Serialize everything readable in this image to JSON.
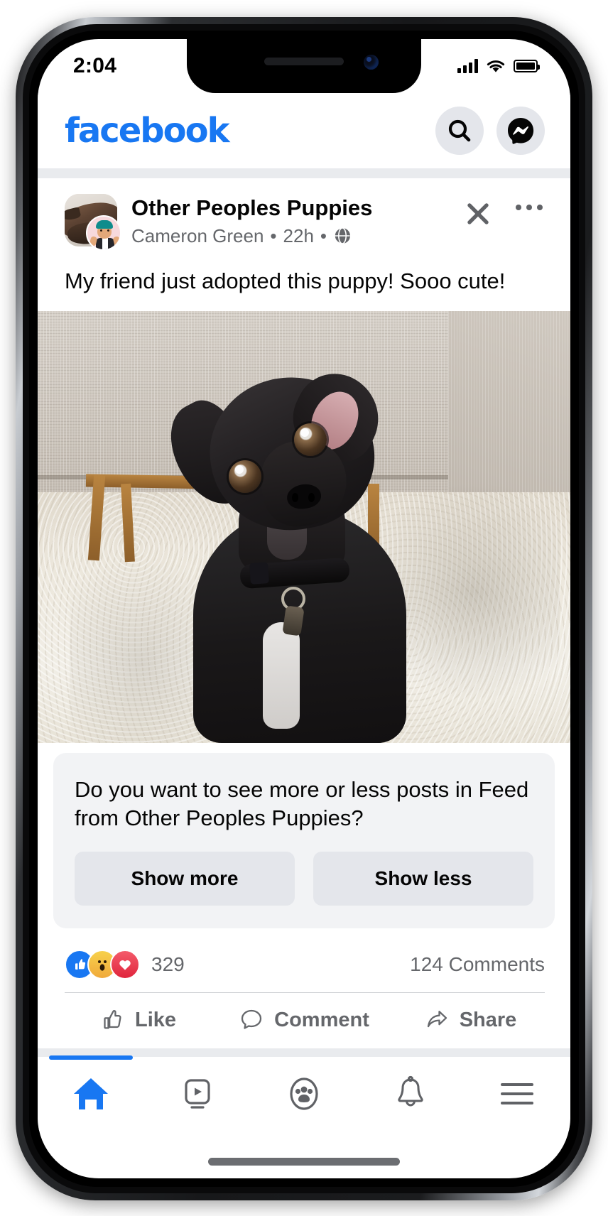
{
  "status_bar": {
    "time": "2:04",
    "signal_icon": "cellular-signal-icon",
    "wifi_icon": "wifi-icon",
    "battery_icon": "battery-full-icon"
  },
  "app_header": {
    "wordmark": "facebook",
    "brand_color": "#1877F2",
    "search_icon": "search-icon",
    "messenger_icon": "messenger-icon"
  },
  "post": {
    "page_name": "Other Peoples Puppies",
    "author": "Cameron Green",
    "timestamp": "22h",
    "separator": "•",
    "audience_icon": "globe-icon",
    "close_icon": "close-icon",
    "menu_icon": "more-options-icon",
    "text": "My friend just adopted this puppy! Sooo cute!",
    "photo_alt": "black puppy sitting on cream shag carpet in front of a gray couch",
    "avatar_name": "page-avatar",
    "mini_avatar_name": "author-mini-avatar"
  },
  "survey": {
    "question": "Do you want to see more or less posts in Feed from Other Peoples Puppies?",
    "show_more_label": "Show more",
    "show_less_label": "Show less",
    "background": "#F2F3F5",
    "button_background": "#E4E6EB"
  },
  "engagement": {
    "reaction_icons": [
      "like-reaction-icon",
      "wow-reaction-icon",
      "love-reaction-icon"
    ],
    "reaction_count": "329",
    "comments": "124 Comments"
  },
  "actions": [
    {
      "label": "Like",
      "icon": "thumbs-up-icon"
    },
    {
      "label": "Comment",
      "icon": "comment-bubble-icon"
    },
    {
      "label": "Share",
      "icon": "share-arrow-icon"
    }
  ],
  "tabbar": {
    "active_index": 0,
    "active_color": "#1877F2",
    "inactive_color": "#606266",
    "items": [
      {
        "name": "home",
        "icon": "home-icon"
      },
      {
        "name": "watch",
        "icon": "video-play-icon"
      },
      {
        "name": "groups",
        "icon": "groups-icon"
      },
      {
        "name": "notifications",
        "icon": "bell-icon"
      },
      {
        "name": "menu",
        "icon": "hamburger-menu-icon"
      }
    ]
  }
}
